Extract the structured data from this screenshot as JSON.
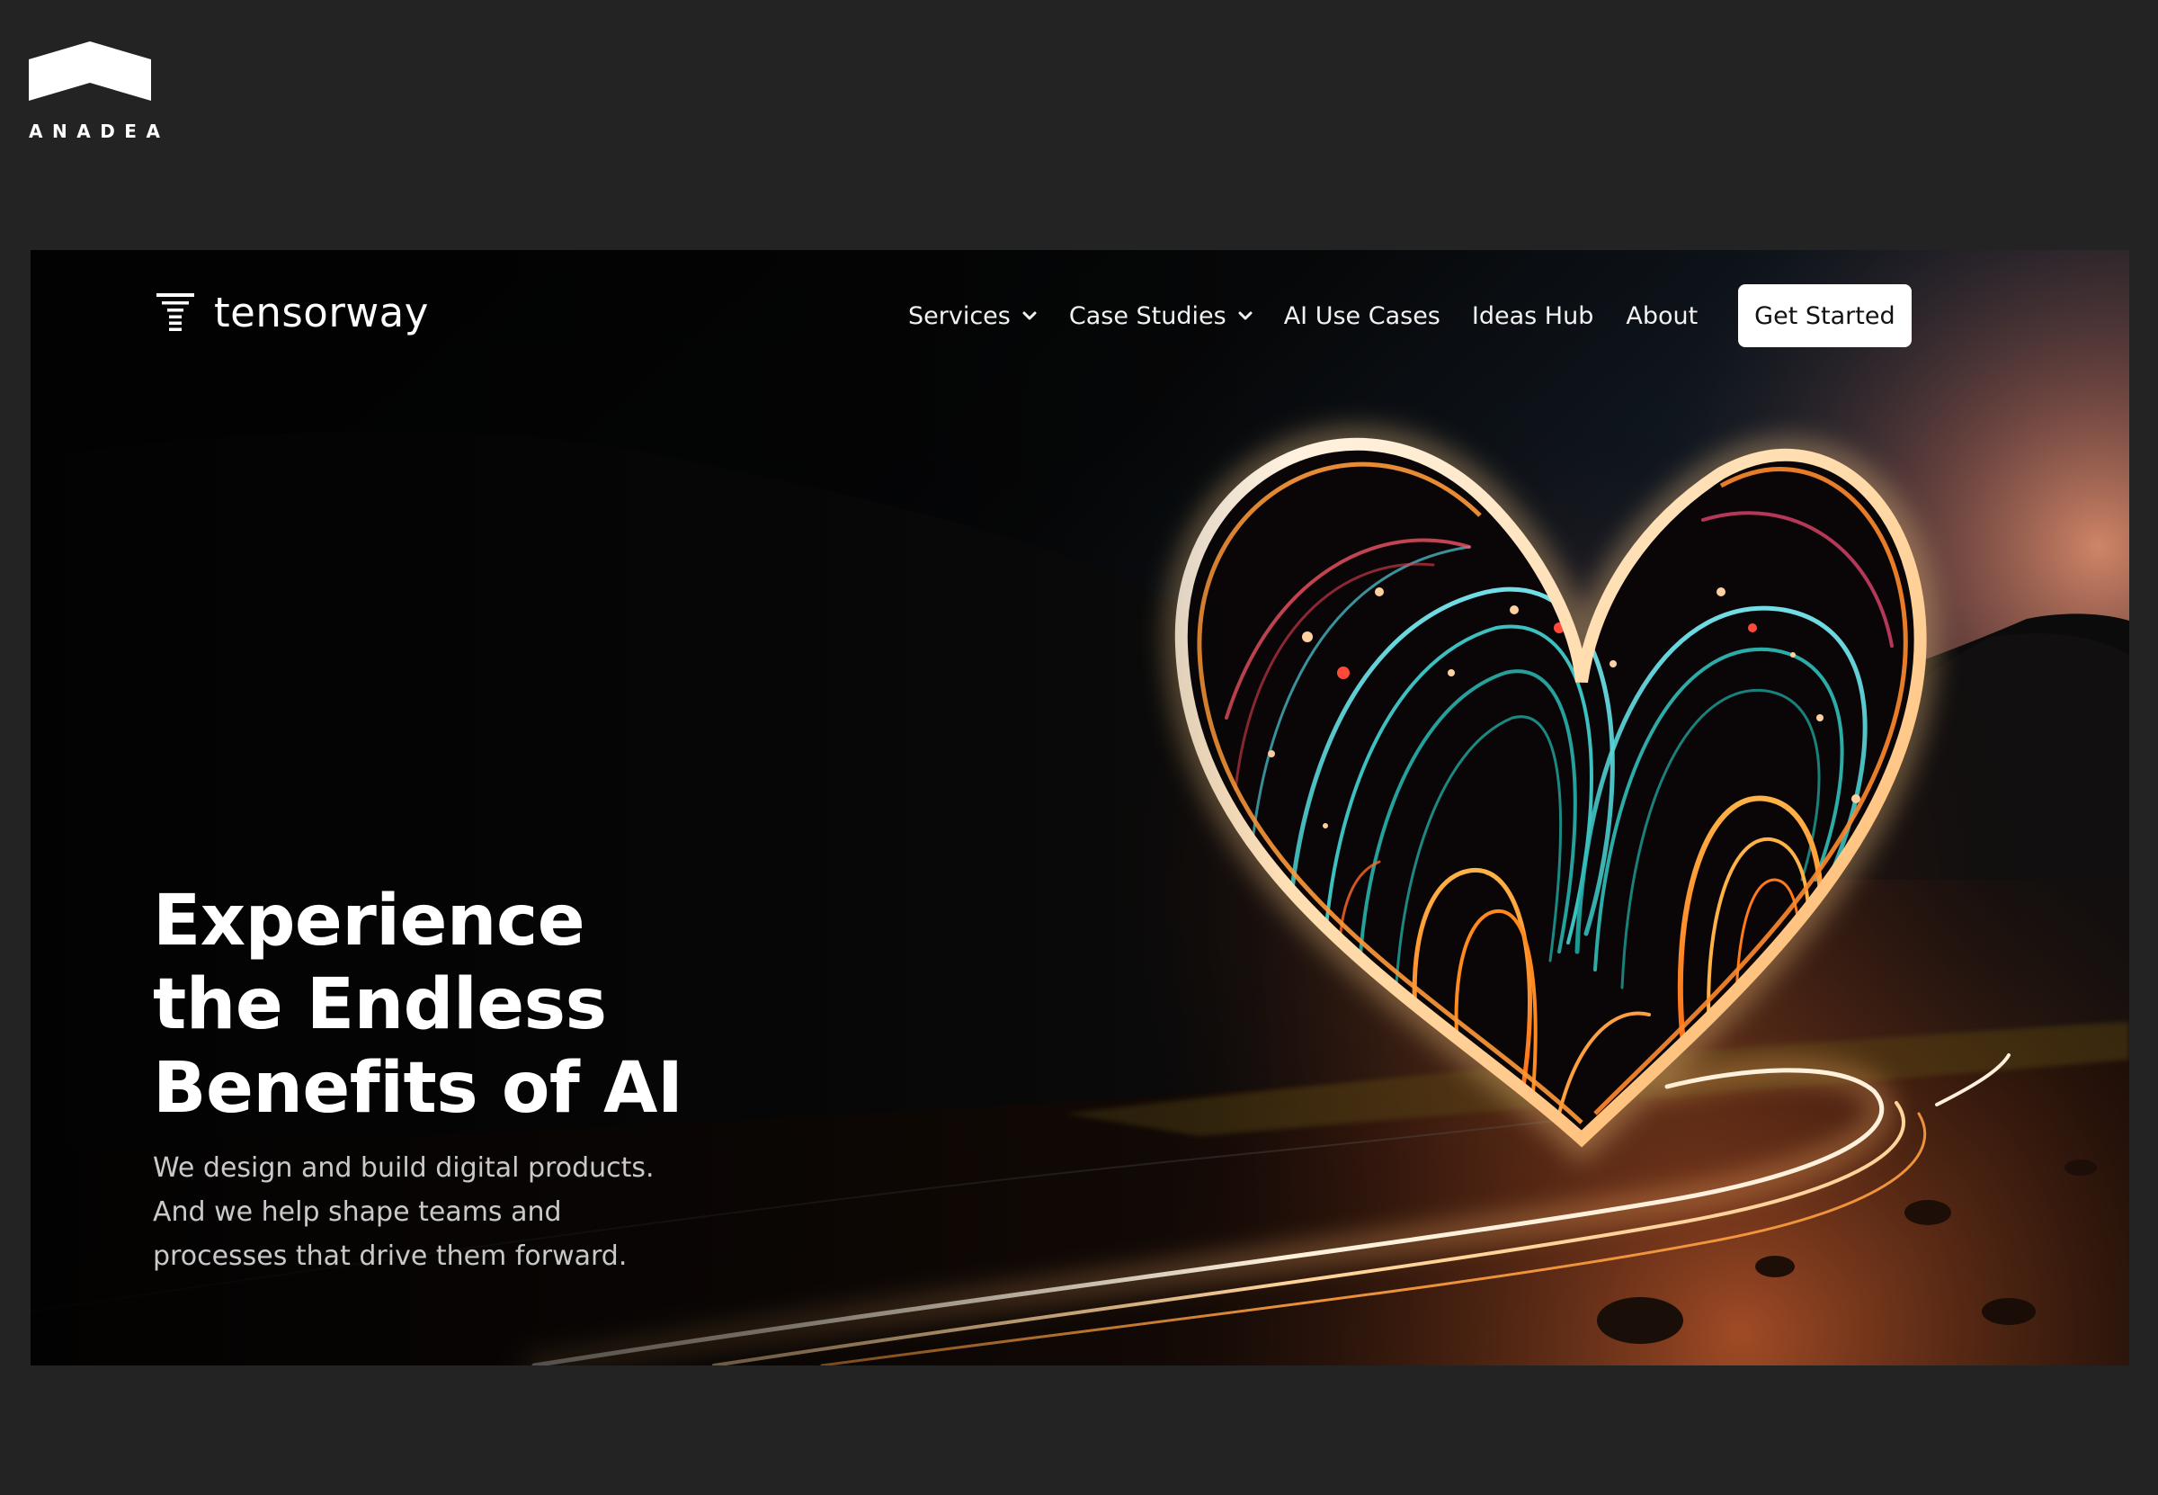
{
  "brand": {
    "name": "ANADEA",
    "logo_icon": "house-roof-icon",
    "color": "#ffffff"
  },
  "site": {
    "logo": {
      "icon": "layered-t-logo-icon",
      "text": "tensorway"
    },
    "nav": {
      "items": [
        {
          "label": "Services",
          "has_dropdown": true
        },
        {
          "label": "Case Studies",
          "has_dropdown": true
        },
        {
          "label": "AI Use Cases",
          "has_dropdown": false
        },
        {
          "label": "Ideas Hub",
          "has_dropdown": false
        },
        {
          "label": "About",
          "has_dropdown": false
        }
      ],
      "cta_label": "Get Started"
    },
    "hero": {
      "title_lines": [
        "Experience",
        "the Endless",
        "Benefits of AI"
      ],
      "subtitle_lines": [
        "We design and build digital products.",
        "And we help shape teams and",
        "processes that drive them forward."
      ],
      "image": "neon-light-heart-over-night-road"
    }
  },
  "colors": {
    "page_background": "#232323",
    "hero_background": "#030303",
    "text_primary": "#ffffff",
    "text_secondary": "#c9c9c9",
    "cta_background": "#ffffff",
    "cta_text": "#111111",
    "sunset_glow": "#e8805a",
    "heart_teal": "#2fd1c5",
    "heart_orange": "#ff8a1e"
  }
}
